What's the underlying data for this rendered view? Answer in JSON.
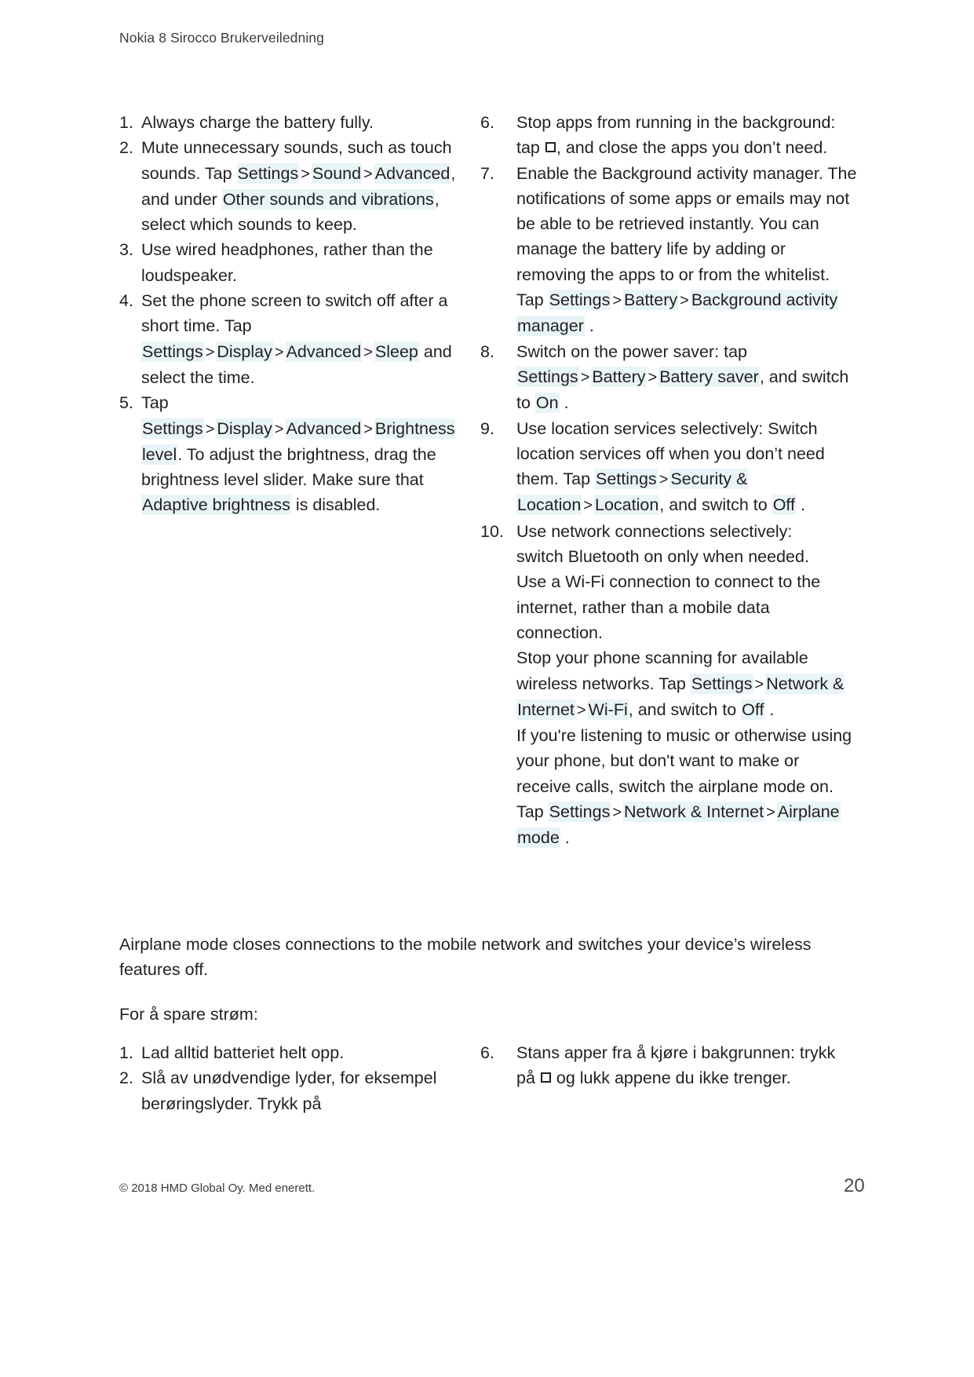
{
  "header": {
    "title": "Nokia 8 Sirocco Brukerveiledning"
  },
  "english_list_left": [
    {
      "num": "1.",
      "parts": [
        {
          "t": "Always charge the battery fully.",
          "hl": false
        }
      ]
    },
    {
      "num": "2.",
      "parts": [
        {
          "t": "Mute unnecessary sounds, such as touch sounds. Tap ",
          "hl": false
        },
        {
          "t": "Settings",
          "hl": true
        },
        {
          "t": ">",
          "hl": false,
          "sep": true
        },
        {
          "t": "Sound",
          "hl": true
        },
        {
          "t": ">",
          "hl": false,
          "sep": true
        },
        {
          "t": "Advanced",
          "hl": true
        },
        {
          "t": ", and under ",
          "hl": false
        },
        {
          "t": "Other sounds and vibrations",
          "hl": true
        },
        {
          "t": ", select which sounds to keep.",
          "hl": false
        }
      ]
    },
    {
      "num": "3.",
      "parts": [
        {
          "t": "Use wired headphones, rather than the loudspeaker.",
          "hl": false
        }
      ]
    },
    {
      "num": "4.",
      "parts": [
        {
          "t": "Set the phone screen to switch off after a short time. Tap ",
          "hl": false
        },
        {
          "t": "Settings",
          "hl": true
        },
        {
          "t": ">",
          "hl": false,
          "sep": true
        },
        {
          "t": "Display",
          "hl": true
        },
        {
          "t": ">",
          "hl": false,
          "sep": true
        },
        {
          "t": "Advanced",
          "hl": true
        },
        {
          "t": ">",
          "hl": false,
          "sep": true
        },
        {
          "t": "Sleep",
          "hl": true
        },
        {
          "t": " and select the time.",
          "hl": false
        }
      ]
    },
    {
      "num": "5.",
      "parts": [
        {
          "t": "Tap ",
          "hl": false
        },
        {
          "t": "Settings",
          "hl": true
        },
        {
          "t": ">",
          "hl": false,
          "sep": true
        },
        {
          "t": "Display",
          "hl": true
        },
        {
          "t": ">",
          "hl": false,
          "sep": true
        },
        {
          "t": "Advanced",
          "hl": true
        },
        {
          "t": ">",
          "hl": false,
          "sep": true
        },
        {
          "t": "Brightness level",
          "hl": true
        },
        {
          "t": ". To adjust the brightness, drag the brightness level slider. Make sure that ",
          "hl": false
        },
        {
          "t": "Adaptive brightness",
          "hl": true
        },
        {
          "t": " is disabled.",
          "hl": false
        }
      ]
    }
  ],
  "english_list_right": [
    {
      "num": "6.",
      "parts": [
        {
          "t": "Stop apps from running in the background: tap ",
          "hl": false
        },
        {
          "t": "",
          "hl": false,
          "icon": "square-recents-icon"
        },
        {
          "t": ", and close the apps you don’t need.",
          "hl": false
        }
      ]
    },
    {
      "num": "7.",
      "parts": [
        {
          "t": "Enable the Background activity manager. The notifications of some apps or emails may not be able to be retrieved instantly. You can manage the battery life by adding or removing the apps to or from the whitelist. Tap ",
          "hl": false
        },
        {
          "t": "Settings",
          "hl": true
        },
        {
          "t": ">",
          "hl": false,
          "sep": true
        },
        {
          "t": "Battery",
          "hl": true
        },
        {
          "t": ">",
          "hl": false,
          "sep": true
        },
        {
          "t": "Background activity manager",
          "hl": true
        },
        {
          "t": " .",
          "hl": false
        }
      ]
    },
    {
      "num": "8.",
      "parts": [
        {
          "t": "Switch on the power saver: tap ",
          "hl": false
        },
        {
          "t": "Settings",
          "hl": true
        },
        {
          "t": ">",
          "hl": false,
          "sep": true
        },
        {
          "t": "Battery",
          "hl": true
        },
        {
          "t": ">",
          "hl": false,
          "sep": true
        },
        {
          "t": "Battery saver",
          "hl": true
        },
        {
          "t": ", and switch to ",
          "hl": false
        },
        {
          "t": "On",
          "hl": true
        },
        {
          "t": " .",
          "hl": false
        }
      ]
    },
    {
      "num": "9.",
      "parts": [
        {
          "t": "Use location services selectively: Switch location services off when you don’t need them. Tap ",
          "hl": false
        },
        {
          "t": "Settings",
          "hl": true
        },
        {
          "t": ">",
          "hl": false,
          "sep": true
        },
        {
          "t": "Security & Location",
          "hl": true
        },
        {
          "t": ">",
          "hl": false,
          "sep": true
        },
        {
          "t": "Location",
          "hl": true
        },
        {
          "t": ", and switch to ",
          "hl": false
        },
        {
          "t": "Off",
          "hl": true
        },
        {
          "t": " .",
          "hl": false
        }
      ]
    },
    {
      "num": "10.",
      "parts": [
        {
          "t": "Use network connections selectively:",
          "hl": false
        },
        {
          "t": "",
          "hl": false,
          "br": true
        },
        {
          "t": "switch Bluetooth on only when needed.",
          "hl": false
        },
        {
          "t": "",
          "hl": false,
          "br": true
        },
        {
          "t": "Use a Wi-Fi connection to connect to the internet, rather than a mobile data connection.",
          "hl": false
        },
        {
          "t": "",
          "hl": false,
          "br": true
        },
        {
          "t": "Stop your phone scanning for available wireless networks. Tap ",
          "hl": false
        },
        {
          "t": "Settings",
          "hl": true
        },
        {
          "t": ">",
          "hl": false,
          "sep": true
        },
        {
          "t": "Network & Internet",
          "hl": true
        },
        {
          "t": ">",
          "hl": false,
          "sep": true
        },
        {
          "t": "Wi-Fi",
          "hl": true
        },
        {
          "t": ", and switch to ",
          "hl": false
        },
        {
          "t": "Off",
          "hl": true
        },
        {
          "t": " .",
          "hl": false
        },
        {
          "t": "",
          "hl": false,
          "br": true
        },
        {
          "t": "If you're listening to music or otherwise using your phone, but don't want to make or receive calls, switch the airplane mode on. Tap ",
          "hl": false
        },
        {
          "t": "Settings",
          "hl": true
        },
        {
          "t": ">",
          "hl": false,
          "sep": true
        },
        {
          "t": "Network & Internet",
          "hl": true
        },
        {
          "t": ">",
          "hl": false,
          "sep": true
        },
        {
          "t": "Airplane mode",
          "hl": true
        },
        {
          "t": " .",
          "hl": false
        }
      ]
    }
  ],
  "note_paragraph": "Airplane mode closes connections to the mobile network and switches your device’s wireless features off.",
  "norwegian_intro": "For å spare strøm:",
  "norwegian_list_left": [
    {
      "num": "1.",
      "parts": [
        {
          "t": "Lad alltid batteriet helt opp.",
          "hl": false
        }
      ]
    },
    {
      "num": "2.",
      "parts": [
        {
          "t": "Slå av unødvendige lyder, for eksempel berøringslyder. Trykk på",
          "hl": false
        }
      ]
    }
  ],
  "norwegian_list_right": [
    {
      "num": "6.",
      "parts": [
        {
          "t": "Stans apper fra å kjøre i bakgrunnen: trykk på ",
          "hl": false
        },
        {
          "t": "",
          "hl": false,
          "icon": "square-recents-icon"
        },
        {
          "t": " og lukk appene du ikke trenger.",
          "hl": false
        }
      ]
    }
  ],
  "footer": {
    "copyright": "© 2018 HMD Global Oy. Med enerett.",
    "page_number": "20"
  },
  "colors": {
    "highlight": "#e8f4f6",
    "text": "#231f20",
    "header_text": "#3b3b3b"
  }
}
